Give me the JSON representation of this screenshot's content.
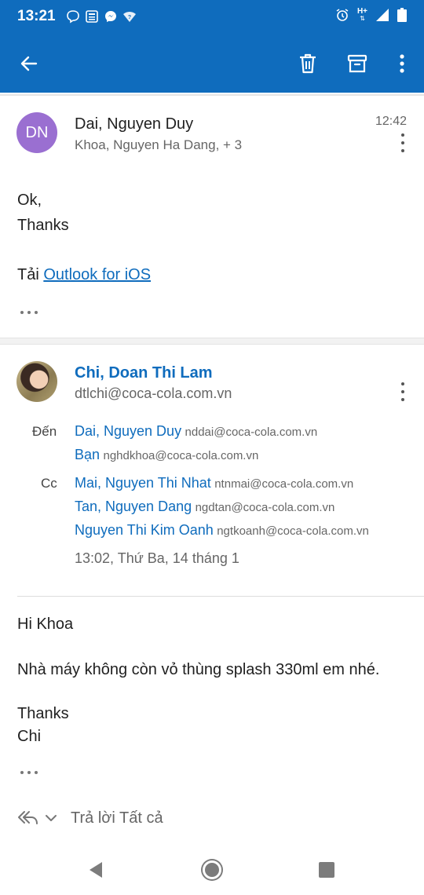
{
  "status_bar": {
    "time": "13:21",
    "network": "H+"
  },
  "message1": {
    "avatar_initials": "DN",
    "avatar_color": "#9a6fd1",
    "sender": "Dai, Nguyen Duy",
    "recipients": "Khoa, Nguyen Ha Dang, + 3",
    "time": "12:42",
    "body": {
      "line1": "Ok,",
      "line2": "Thanks",
      "download_prefix": "Tải ",
      "download_link": "Outlook for iOS"
    }
  },
  "message2": {
    "sender": "Chi, Doan Thi Lam",
    "sender_email": "dtlchi@coca-cola.com.vn",
    "to_label": "Đến",
    "cc_label": "Cc",
    "to": [
      {
        "name": "Dai, Nguyen Duy",
        "email": "nddai@coca-cola.com.vn"
      },
      {
        "name": "Bạn",
        "email": "nghdkhoa@coca-cola.com.vn"
      }
    ],
    "cc": [
      {
        "name": "Mai, Nguyen Thi Nhat",
        "email": "ntnmai@coca-cola.com.vn"
      },
      {
        "name": "Tan, Nguyen Dang",
        "email": "ngdtan@coca-cola.com.vn"
      },
      {
        "name": "Nguyen Thi Kim Oanh",
        "email": "ngtkoanh@coca-cola.com.vn"
      }
    ],
    "date": "13:02, Thứ Ba, 14 tháng 1",
    "body": {
      "line1": "Hi Khoa",
      "line2": "Nhà máy không còn vỏ thùng splash 330ml em nhé.",
      "line3": "Thanks",
      "line4": "Chi"
    }
  },
  "reply_bar": {
    "label": "Trả lời Tất cả"
  },
  "colors": {
    "accent": "#0f6cbd",
    "secondary_text": "#666666"
  }
}
